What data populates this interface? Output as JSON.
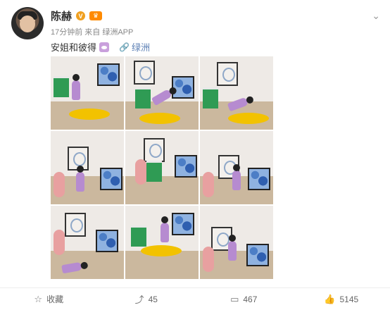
{
  "post": {
    "username": "陈赫",
    "meta": "17分钟前 来自 绿洲APP",
    "text": "安姐和彼得",
    "link": "绿洲"
  },
  "photos": [
    "photo-1",
    "photo-2",
    "photo-3",
    "photo-4",
    "photo-5",
    "photo-6",
    "photo-7",
    "photo-8",
    "photo-9"
  ],
  "footer": {
    "favorite": "收藏",
    "repost": "45",
    "comment": "467",
    "like": "5145"
  },
  "icons": {
    "favorite": "star-icon",
    "repost": "share-icon",
    "comment": "comment-icon",
    "like": "thumbs-up-icon"
  }
}
